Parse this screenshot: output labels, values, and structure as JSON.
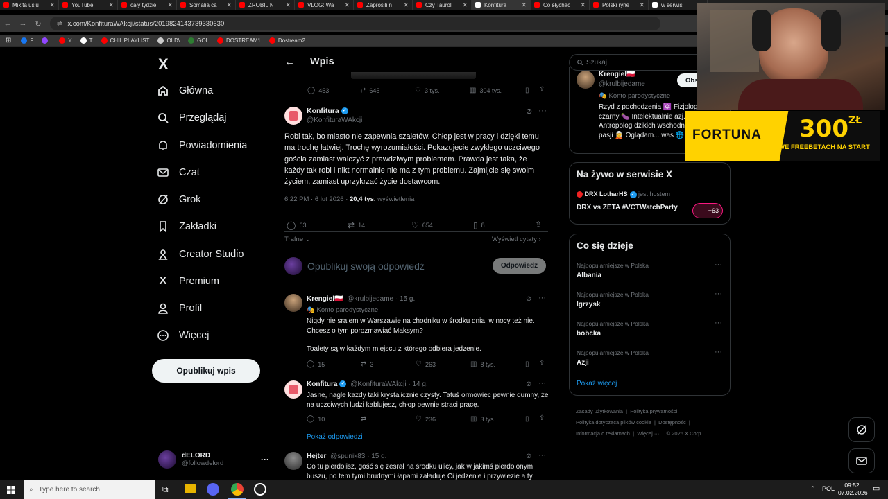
{
  "browser": {
    "tabs": [
      {
        "label": "Mikita uslu",
        "color": "#ff0000"
      },
      {
        "label": "YouTube",
        "color": "#ff0000"
      },
      {
        "label": "cały tydzie",
        "color": "#ff0000"
      },
      {
        "label": "Somalia ca",
        "color": "#ff0000"
      },
      {
        "label": "ZROBIL N",
        "color": "#ff0000"
      },
      {
        "label": "VLOG: Wa",
        "color": "#ff0000"
      },
      {
        "label": "Zaprosili n",
        "color": "#ff0000"
      },
      {
        "label": "Czy Taurol",
        "color": "#ff0000"
      },
      {
        "label": "Konfitura",
        "color": "#ffffff"
      },
      {
        "label": "Co słychać",
        "color": "#ff0000"
      },
      {
        "label": "Polski ryne",
        "color": "#ff0000"
      },
      {
        "label": "w serwis",
        "color": "#ffffff"
      }
    ],
    "url": "x.com/KonfituraWAkcji/status/2019824143739330630",
    "bookmarks": [
      {
        "label": "F",
        "color": "#1877f2"
      },
      {
        "label": "",
        "color": "#9146ff"
      },
      {
        "label": "Y",
        "color": "#ff0000"
      },
      {
        "label": "T",
        "color": "#ffffff"
      },
      {
        "label": "CHIL PLAYLIST",
        "color": "#ff0000"
      },
      {
        "label": "OLD\\",
        "color": "#cccccc"
      },
      {
        "label": "GOL",
        "color": "#2e7d32"
      },
      {
        "label": "DOSTREAM1",
        "color": "#ff0000"
      },
      {
        "label": "Dostream2",
        "color": "#ff0000"
      }
    ]
  },
  "nav": {
    "logo": "X",
    "items": [
      {
        "label": "Główna",
        "icon": "home-icon"
      },
      {
        "label": "Przeglądaj",
        "icon": "search-icon"
      },
      {
        "label": "Powiadomienia",
        "icon": "bell-icon"
      },
      {
        "label": "Czat",
        "icon": "mail-icon"
      },
      {
        "label": "Grok",
        "icon": "grok-icon"
      },
      {
        "label": "Zakładki",
        "icon": "bookmark-icon"
      },
      {
        "label": "Creator Studio",
        "icon": "creator-icon"
      },
      {
        "label": "Premium",
        "icon": "x-icon"
      },
      {
        "label": "Profil",
        "icon": "person-icon"
      },
      {
        "label": "Więcej",
        "icon": "more-icon"
      }
    ],
    "post_button": "Opublikuj wpis",
    "account": {
      "name": "dELORD",
      "handle": "@followdelord",
      "more": "···"
    }
  },
  "header": {
    "title": "Wpis",
    "back": "←"
  },
  "prev_stats": {
    "replies": "453",
    "reposts": "645",
    "likes": "3 tys.",
    "views": "304 tys."
  },
  "main_post": {
    "author": "Konfitura",
    "handle": "@KonfituraWAkcji",
    "text": "Robi tak, bo miasto nie zapewnia szaletów. Chłop jest w pracy i dzięki temu ma trochę łatwiej. Trochę wyrozumiałości. Pokazujecie zwykłego uczciwego gościa zamiast walczyć z prawdziwym problemem. Prawda jest taka, że każdy tak robi i nikt normalnie nie ma z tym problemu. Zajmijcie się swoim życiem, zamiast uprzykrzać życie dostawcom.",
    "time": "6:22 PM · 6 lut 2026 · ",
    "views_value": "20,4 tys.",
    "views_label": " wyświetlenia",
    "replies": "63",
    "reposts": "14",
    "likes": "654",
    "bookmarks": "8",
    "sort_label": "Trafne",
    "quotes_label": "Wyświetl cytaty"
  },
  "reply_box": {
    "placeholder": "Opublikuj swoją odpowiedź",
    "button": "Odpowiedz"
  },
  "replies": [
    {
      "author": "Krengiel🇵🇱",
      "handle": "@krulbijedame · 15 g.",
      "badge": "Konto parodystyczne",
      "text1": "Nigdy nie sralem w Warszawie na chodniku w środku dnia, w nocy też nie. Chcesz o tym porozmawiać Maksym?",
      "text2": "Toalety są w każdym miejscu z którego odbiera jedzenie.",
      "replies": "15",
      "reposts": "3",
      "likes": "263",
      "views": "8 tys."
    },
    {
      "author": "Konfitura",
      "handle": "@KonfituraWAkcji · 14 g.",
      "text1": "Jasne, nagle każdy taki krystalicznie czysty. Tatuś ormowiec pewnie dumny, że na uczciwych ludzi kablujesz, chłop pewnie straci pracę.",
      "replies": "10",
      "reposts": "",
      "likes": "236",
      "views": "3 tys.",
      "show_replies": "Pokaż odpowiedzi"
    },
    {
      "author": "Hejter",
      "handle": "@spunik83 · 15 g.",
      "text1": "Co tu pierdolisz, gość się zesrał na środku ulicy, jak w jakimś pierdolonym buszu, po tem tymi brudnymi łapami załaduje Ci jedzenie i przywiezie a ty"
    }
  ],
  "right": {
    "search_placeholder": "Szukaj",
    "profile_card": {
      "name": "Krengiel🇵🇱",
      "handle": "@krulbijedame",
      "follow": "Obs",
      "badge": "Konto parodystyczne",
      "bio": "Rzyd z pochodzenia 🔯 Fizjologicznie czarny 🍆 Intelektualnie azj... Antropolog dzikich wschodn... plemion z pasji 🧝 Oglądam... was 🌐"
    },
    "live": {
      "title": "Na żywo w serwisie X",
      "host": "DRX LotharHS",
      "host_suffix": " jest hostem",
      "event": "DRX vs ZETA #VCTWatchParty",
      "count": "+63"
    },
    "trends": {
      "title": "Co się dzieje",
      "items": [
        {
          "context": "Najpopularniejsze w Polska",
          "name": "Albania"
        },
        {
          "context": "Najpopularniejsze w Polska",
          "name": "Igrzysk"
        },
        {
          "context": "Najpopularniejsze w Polska",
          "name": "bobcka"
        },
        {
          "context": "Najpopularniejsze w Polska",
          "name": "Azji"
        }
      ],
      "more": "Pokaż więcej"
    },
    "footer": {
      "l1": "Zasady użytkowania",
      "l2": "Polityka prywatności",
      "l3": "Polityka dotycząca plików cookie",
      "l4": "Dostępność",
      "l5": "Informacja o reklamach",
      "l6": "Więcej ···",
      "l7": "© 2026 X Corp."
    }
  },
  "overlay": {
    "brand": "FORTUNA",
    "amount": "300",
    "currency": "ZŁ",
    "promo": "WE FREEBETACH NA START"
  },
  "taskbar": {
    "search_placeholder": "Type here to search",
    "lang": "POL",
    "time": "09:52",
    "date": "07.02.2026"
  }
}
